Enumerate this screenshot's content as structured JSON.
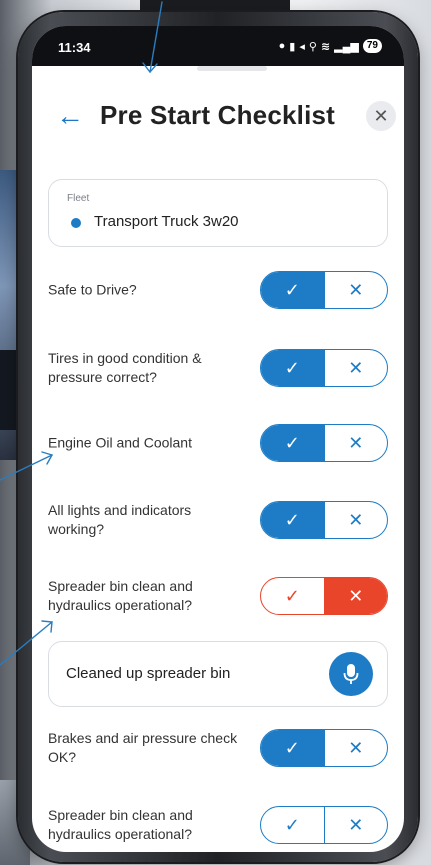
{
  "status_bar": {
    "time": "11:34",
    "battery": "79"
  },
  "header": {
    "title": "Pre Start Checklist",
    "back_icon": "arrow-left-icon",
    "close_icon": "close-icon"
  },
  "fleet": {
    "label": "Fleet",
    "value": "Transport Truck 3w20",
    "dot_color": "#1d7cc5"
  },
  "checklist": [
    {
      "label": "Safe to Drive?",
      "state": "yes"
    },
    {
      "label": "Tires in good condition & pressure correct?",
      "state": "yes"
    },
    {
      "label": "Engine Oil and Coolant",
      "state": "yes"
    },
    {
      "label": "All lights and indicators working?",
      "state": "yes"
    },
    {
      "label": "Spreader bin clean and hydraulics operational?",
      "state": "no"
    },
    {
      "label": "Brakes and air pressure check OK?",
      "state": "yes"
    },
    {
      "label": "Spreader bin clean and hydraulics operational?",
      "state": "none"
    }
  ],
  "comment": {
    "text": "Cleaned up spreader bin",
    "mic_icon": "microphone-icon"
  },
  "colors": {
    "accent": "#1d7cc5",
    "fail": "#e8452b"
  }
}
